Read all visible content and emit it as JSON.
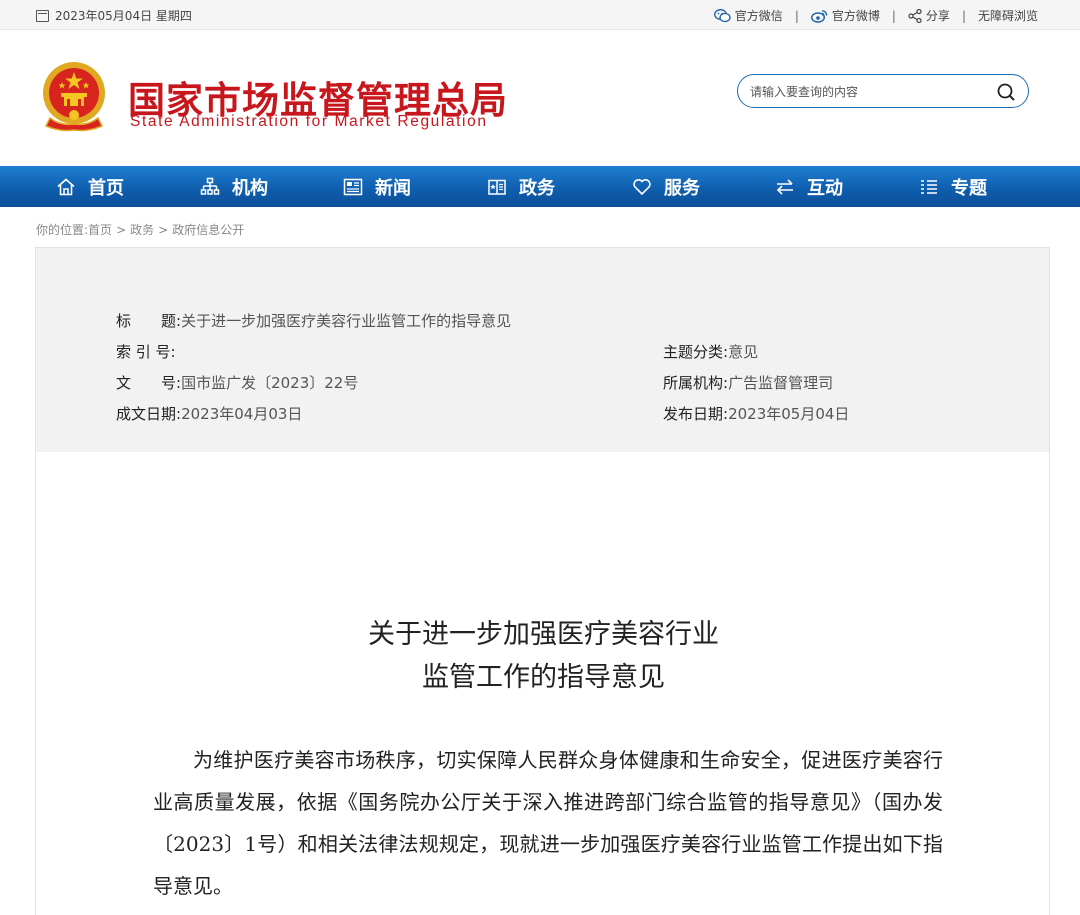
{
  "topbar": {
    "date": "2023年05月04日 星期四",
    "links": [
      {
        "label": "官方微信",
        "icon": "wechat-icon"
      },
      {
        "label": "官方微博",
        "icon": "weibo-icon"
      },
      {
        "label": "分享",
        "icon": "share-icon"
      },
      {
        "label": "无障碍浏览",
        "icon": ""
      }
    ]
  },
  "header": {
    "title_cn": "国家市场监督管理总局",
    "title_en": "State Administration for Market Regulation",
    "brand_color": "#c8161d"
  },
  "search": {
    "placeholder": "请输入要查询的内容",
    "value": ""
  },
  "nav": {
    "bg_color": "#0f5eae",
    "items": [
      {
        "label": "首页",
        "icon": "home-icon"
      },
      {
        "label": "机构",
        "icon": "org-icon"
      },
      {
        "label": "新闻",
        "icon": "news-icon"
      },
      {
        "label": "政务",
        "icon": "government-icon"
      },
      {
        "label": "服务",
        "icon": "heart-icon"
      },
      {
        "label": "互动",
        "icon": "exchange-icon"
      },
      {
        "label": "专题",
        "icon": "list-icon"
      }
    ]
  },
  "breadcrumb": {
    "prefix": "你的位置:",
    "items": [
      "首页",
      "政务",
      "政府信息公开"
    ],
    "separator": ">"
  },
  "meta": {
    "title_label": "标　　题:",
    "title_value": "关于进一步加强医疗美容行业监管工作的指导意见",
    "index_label": "索 引 号:",
    "index_value": "",
    "docno_label": "文　　号:",
    "docno_value": "国市监广发〔2023〕22号",
    "date_label": "成文日期:",
    "date_value": "2023年04月03日",
    "topic_label": "主题分类:",
    "topic_value": "意见",
    "org_label": "所属机构:",
    "org_value": "广告监督管理司",
    "pub_label": "发布日期:",
    "pub_value": "2023年05月04日"
  },
  "article": {
    "title_line1": "关于进一步加强医疗美容行业",
    "title_line2": "监管工作的指导意见",
    "paragraph1": "为维护医疗美容市场秩序，切实保障人民群众身体健康和生命安全，促进医疗美容行业高质量发展，依据《国务院办公厅关于深入推进跨部门综合监管的指导意见》（国办发〔2023〕1号）和相关法律法规规定，现就进一步加强医疗美容行业监管工作提出如下指导意见。"
  }
}
